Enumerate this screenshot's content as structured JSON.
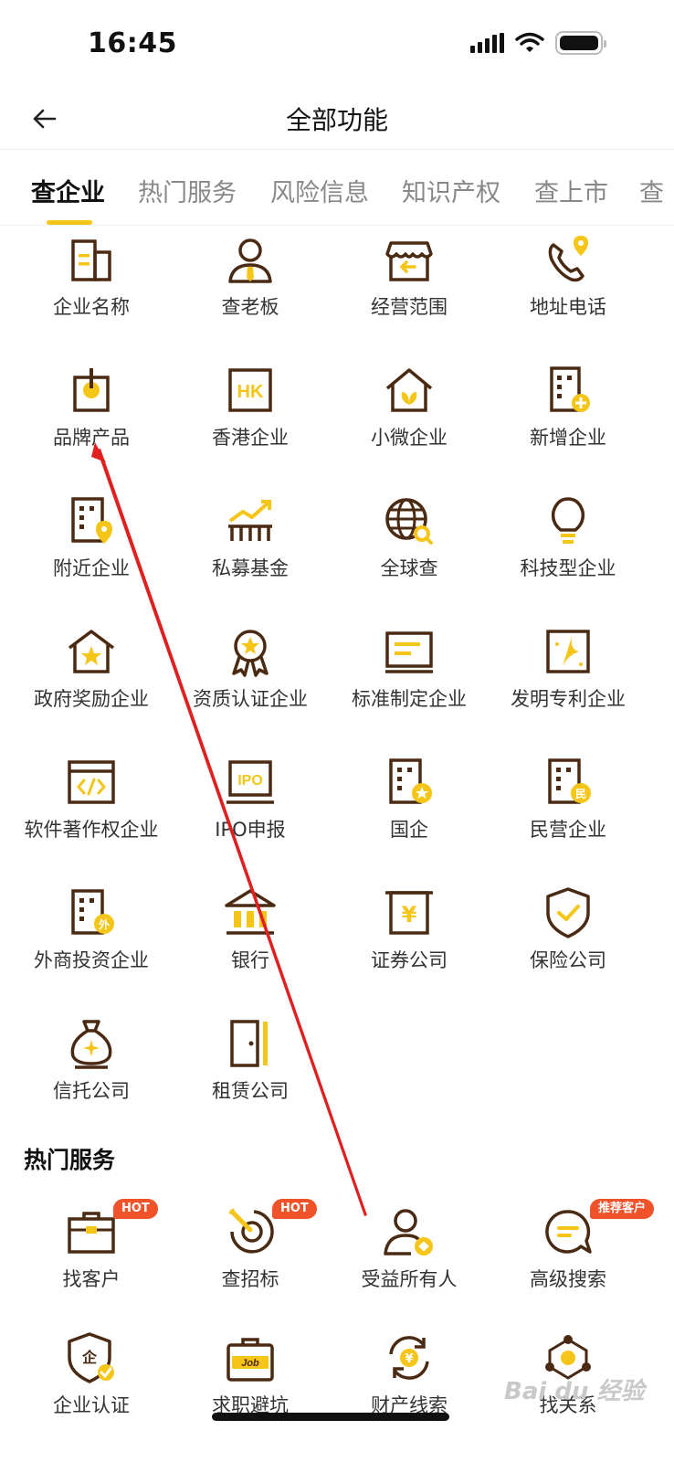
{
  "status_bar": {
    "time": "16:45"
  },
  "nav": {
    "title": "全部功能"
  },
  "tabs": [
    {
      "label": "查企业",
      "active": true
    },
    {
      "label": "热门服务"
    },
    {
      "label": "风险信息"
    },
    {
      "label": "知识产权"
    },
    {
      "label": "查上市"
    },
    {
      "label": "查"
    }
  ],
  "company_items": [
    {
      "label": "企业名称",
      "icon": "building-icon"
    },
    {
      "label": "查老板",
      "icon": "boss-icon"
    },
    {
      "label": "经营范围",
      "icon": "shop-icon"
    },
    {
      "label": "地址电话",
      "icon": "phone-location-icon"
    },
    {
      "label": "品牌产品",
      "icon": "brand-product-icon"
    },
    {
      "label": "香港企业",
      "icon": "hk-icon"
    },
    {
      "label": "小微企业",
      "icon": "small-business-icon"
    },
    {
      "label": "新增企业",
      "icon": "new-company-icon"
    },
    {
      "label": "附近企业",
      "icon": "nearby-company-icon"
    },
    {
      "label": "私募基金",
      "icon": "fund-icon"
    },
    {
      "label": "全球查",
      "icon": "globe-search-icon"
    },
    {
      "label": "科技型企业",
      "icon": "bulb-icon"
    },
    {
      "label": "政府奖励企业",
      "icon": "award-house-icon"
    },
    {
      "label": "资质认证企业",
      "icon": "rosette-icon"
    },
    {
      "label": "标准制定企业",
      "icon": "standard-doc-icon"
    },
    {
      "label": "发明专利企业",
      "icon": "patent-icon"
    },
    {
      "label": "软件著作权企业",
      "icon": "code-window-icon"
    },
    {
      "label": "IPO申报",
      "icon": "ipo-icon"
    },
    {
      "label": "国企",
      "icon": "state-owned-icon"
    },
    {
      "label": "民营企业",
      "icon": "private-company-icon"
    },
    {
      "label": "外商投资企业",
      "icon": "foreign-company-icon"
    },
    {
      "label": "银行",
      "icon": "bank-icon"
    },
    {
      "label": "证券公司",
      "icon": "securities-icon"
    },
    {
      "label": "保险公司",
      "icon": "shield-check-icon"
    },
    {
      "label": "信托公司",
      "icon": "money-bag-icon"
    },
    {
      "label": "租赁公司",
      "icon": "door-icon"
    }
  ],
  "hot_services": {
    "title": "热门服务",
    "items": [
      {
        "label": "找客户",
        "icon": "briefcase-icon",
        "badge": "HOT"
      },
      {
        "label": "查招标",
        "icon": "target-icon",
        "badge": "HOT"
      },
      {
        "label": "受益所有人",
        "icon": "beneficiary-icon"
      },
      {
        "label": "高级搜索",
        "icon": "chat-search-icon",
        "badge": "推荐客户"
      },
      {
        "label": "企业认证",
        "icon": "shield-verify-icon"
      },
      {
        "label": "求职避坑",
        "icon": "job-bag-icon"
      },
      {
        "label": "财产线索",
        "icon": "property-cycle-icon"
      },
      {
        "label": "找关系",
        "icon": "network-icon"
      }
    ]
  },
  "watermark": "Bai du 经验",
  "colors": {
    "accent": "#f5c518",
    "icon_brown": "#4a2a12",
    "badge": "#f0522a",
    "annotation": "#e02020"
  }
}
